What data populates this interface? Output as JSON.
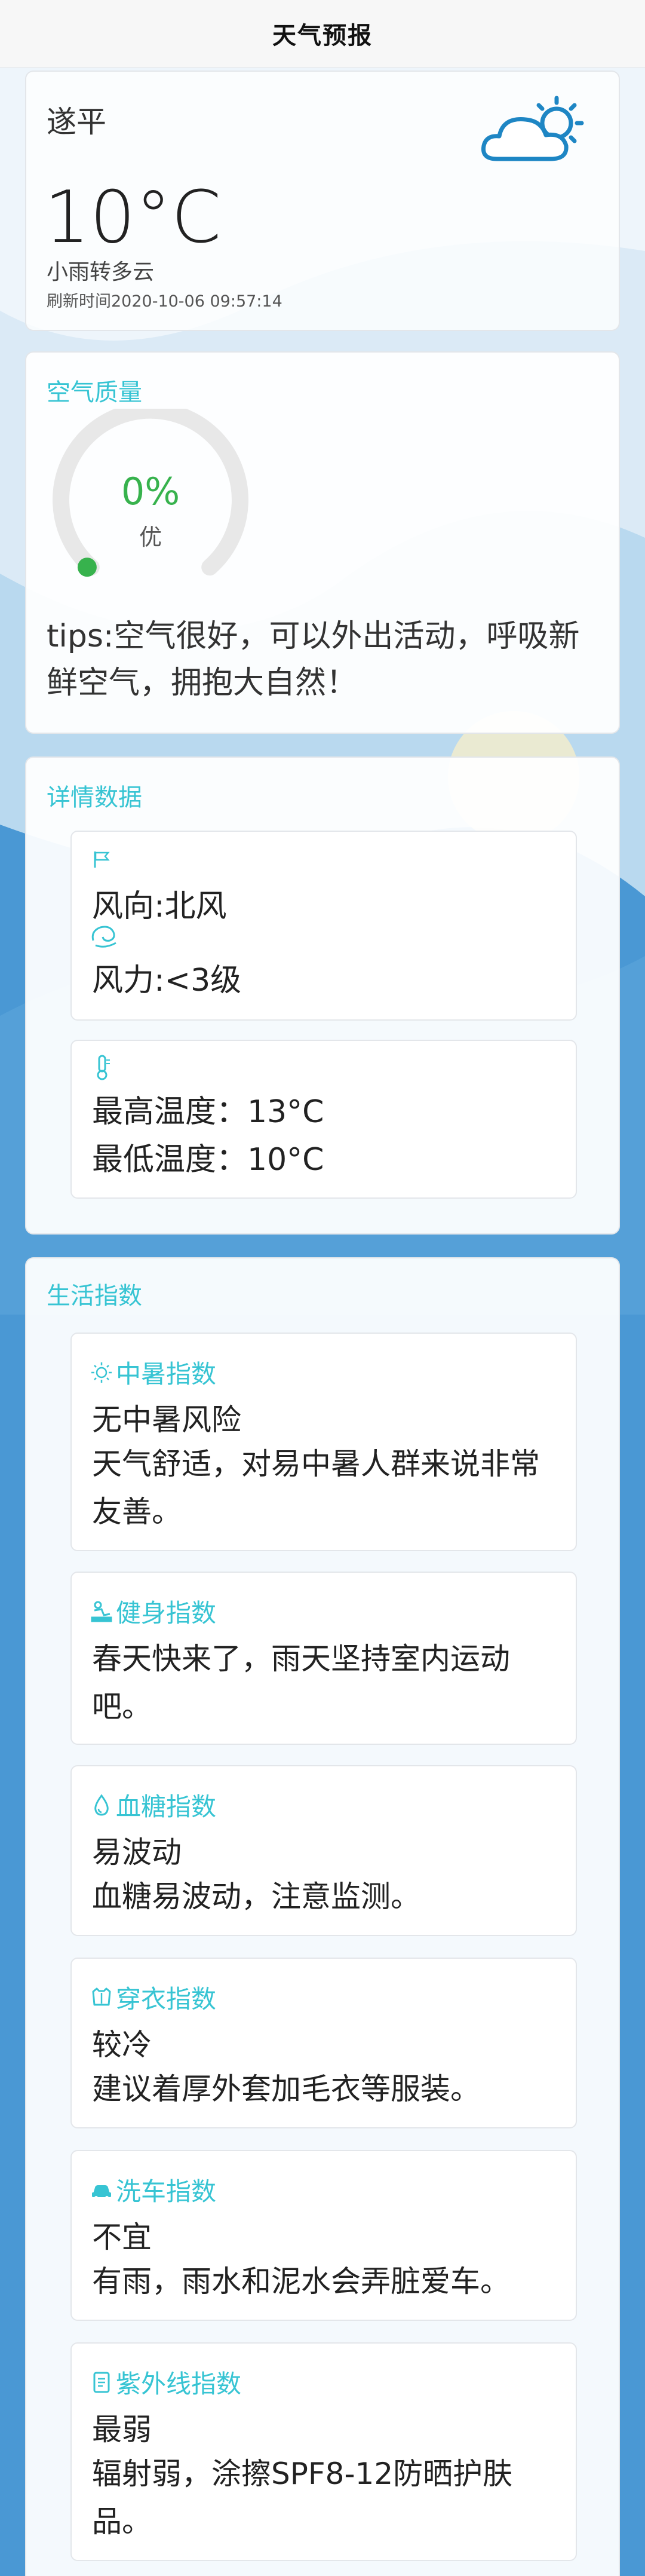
{
  "header": {
    "title": "天气预报"
  },
  "weather": {
    "city": "遂平",
    "temperature": "10°C",
    "description": "小雨转多云",
    "refresh_label": "刷新时间",
    "refresh_time": "2020-10-06 09:57:14",
    "icon": "partly-cloudy-sun-icon"
  },
  "air_quality": {
    "title": "空气质量",
    "value": "0%",
    "level": "优",
    "gauge_fraction": 0,
    "tips": "tips:空气很好，可以外出活动，呼吸新鲜空气，拥抱大自然！",
    "accent": "#37b24d"
  },
  "details": {
    "title": "详情数据",
    "wind_direction": "风向:北风",
    "wind_power": "风力:<3级",
    "max_temp": "最高温度：13°C",
    "min_temp": "最低温度：10°C"
  },
  "life": {
    "title": "生活指数",
    "items": [
      {
        "name": "中暑指数",
        "icon": "sun-icon",
        "level": "无中暑风险",
        "text": "天气舒适，对易中暑人群来说非常友善。"
      },
      {
        "name": "健身指数",
        "icon": "fitness-icon",
        "level": "",
        "text": "春天快来了，雨天坚持室内运动吧。"
      },
      {
        "name": "血糖指数",
        "icon": "drop-icon",
        "level": "易波动",
        "text": "血糖易波动，注意监测。"
      },
      {
        "name": "穿衣指数",
        "icon": "clothes-icon",
        "level": "较冷",
        "text": "建议着厚外套加毛衣等服装。"
      },
      {
        "name": "洗车指数",
        "icon": "car-icon",
        "level": "不宜",
        "text": "有雨，雨水和泥水会弄脏爱车。"
      },
      {
        "name": "紫外线指数",
        "icon": "uv-icon",
        "level": "最弱",
        "text": "辐射弱，涂擦SPF8-12防晒护肤品。"
      }
    ]
  },
  "colors": {
    "accent": "#37c4d3",
    "background": "#4a98d4",
    "good": "#37b24d"
  }
}
